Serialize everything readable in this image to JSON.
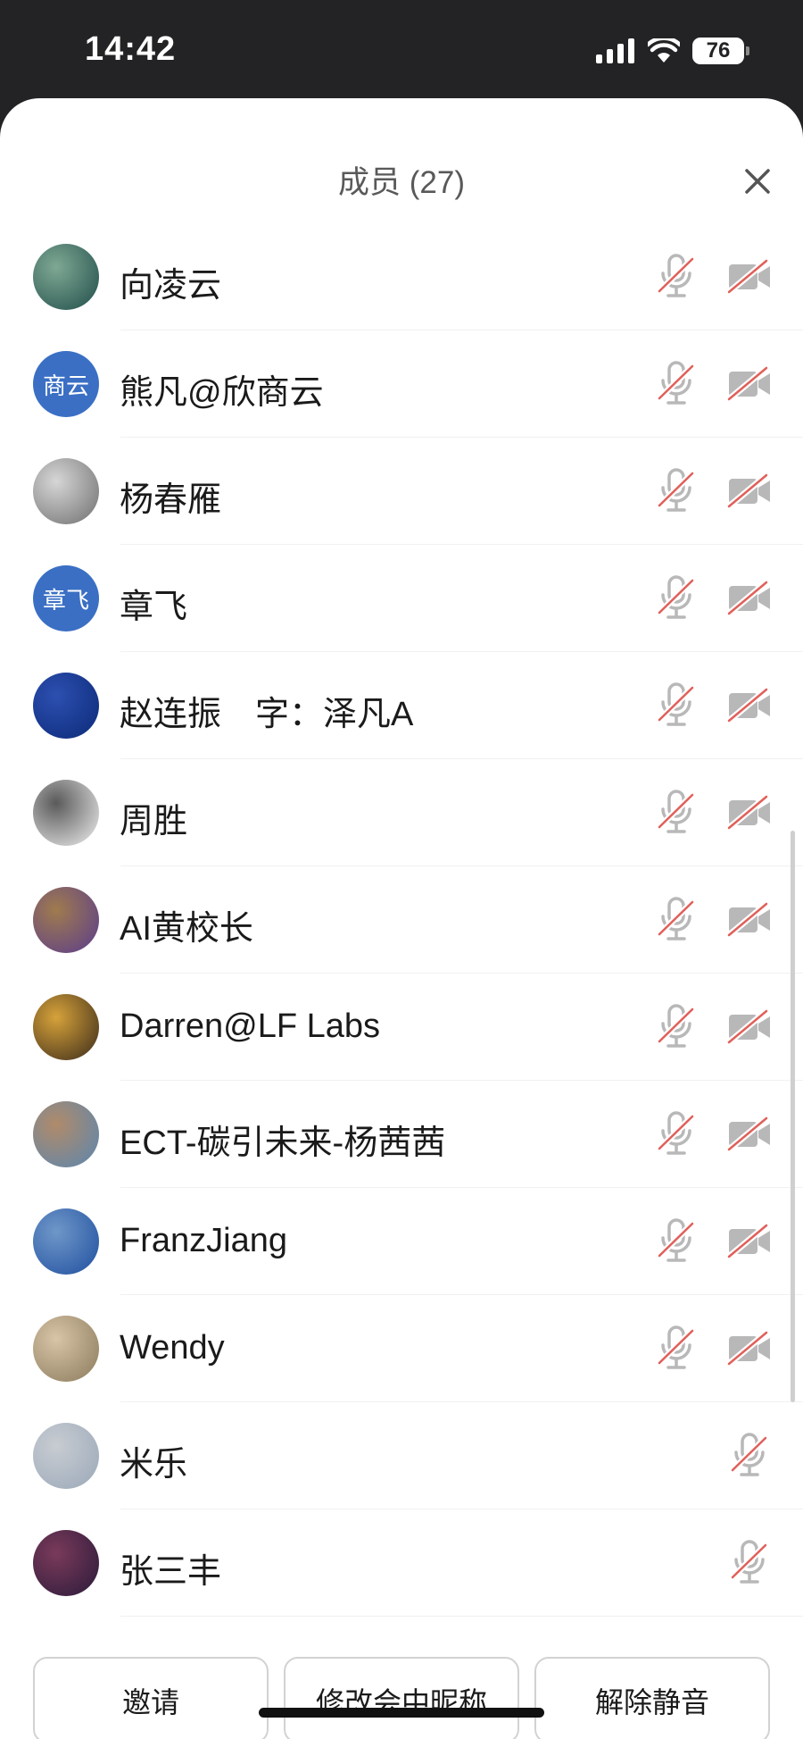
{
  "status_bar": {
    "time": "14:42",
    "battery": "76"
  },
  "header": {
    "title": "成员 (27)"
  },
  "members": [
    {
      "name": "向凌云",
      "avatar_type": "image",
      "avatar_colors": [
        "#1f4d4a",
        "#7fa893"
      ],
      "video": true
    },
    {
      "name": "熊凡@欣商云",
      "avatar_type": "text",
      "avatar_text": "商云",
      "avatar_colors": [
        "#3a6fc4",
        "#3a6fc4"
      ],
      "video": true
    },
    {
      "name": "杨春雁",
      "avatar_type": "image",
      "avatar_colors": [
        "#6e6e6e",
        "#d6d6d6"
      ],
      "video": true
    },
    {
      "name": "章飞",
      "avatar_type": "text",
      "avatar_text": "章飞",
      "avatar_colors": [
        "#3a6fc4",
        "#3a6fc4"
      ],
      "video": true
    },
    {
      "name": "赵连振　字：泽凡A",
      "avatar_type": "image",
      "avatar_colors": [
        "#0b2a78",
        "#2d4fb0"
      ],
      "video": true
    },
    {
      "name": "周胜",
      "avatar_type": "image",
      "avatar_colors": [
        "#f0f0f0",
        "#5a5a5a"
      ],
      "video": true
    },
    {
      "name": "AI黄校长",
      "avatar_type": "image",
      "avatar_colors": [
        "#5a3c8c",
        "#a07b4e"
      ],
      "video": true
    },
    {
      "name": "Darren@LF Labs",
      "avatar_type": "image",
      "avatar_colors": [
        "#3a2a1a",
        "#d6a23a"
      ],
      "video": true
    },
    {
      "name": "ECT-碳引未来-杨茜茜",
      "avatar_type": "image",
      "avatar_colors": [
        "#5a86b0",
        "#b08b6a"
      ],
      "video": true
    },
    {
      "name": "FranzJiang",
      "avatar_type": "image",
      "avatar_colors": [
        "#1f4fa0",
        "#6f97c8"
      ],
      "video": true
    },
    {
      "name": "Wendy",
      "avatar_type": "image",
      "avatar_colors": [
        "#8a7a5a",
        "#d8c4a8"
      ],
      "video": true
    },
    {
      "name": "米乐",
      "avatar_type": "image",
      "avatar_colors": [
        "#9aa8b8",
        "#c8ccd2"
      ],
      "video": false
    },
    {
      "name": "张三丰",
      "avatar_type": "image",
      "avatar_colors": [
        "#2a1a3a",
        "#7a3a5a"
      ],
      "video": false
    }
  ],
  "footer": {
    "invite_label": "邀请",
    "rename_label": "修改会中昵称",
    "unmute_label": "解除静音"
  },
  "colors": {
    "muted_icon": "#b8b8b8",
    "mute_slash": "#e0605a"
  }
}
